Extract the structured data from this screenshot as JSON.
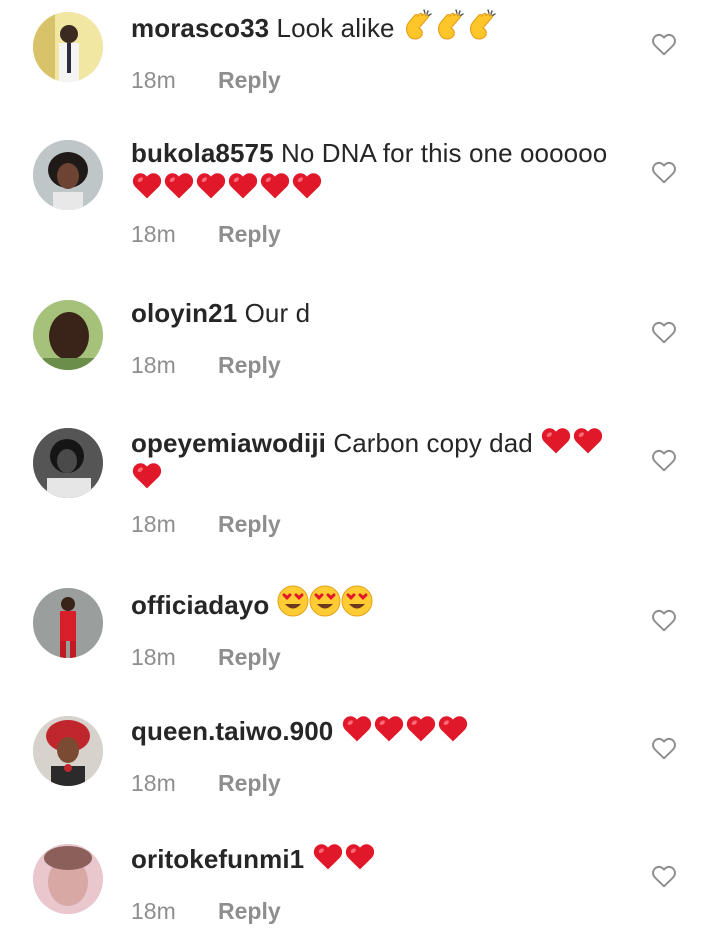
{
  "comments": [
    {
      "username": "morasco33",
      "text": "Look alike",
      "time": "18m",
      "reply": "Reply",
      "emoji": "clap",
      "emoji_count": 3
    },
    {
      "username": "bukola8575",
      "text": "No DNA for this one oooooo",
      "time": "18m",
      "reply": "Reply",
      "emoji": "heart",
      "emoji_count": 6
    },
    {
      "username": "oloyin21",
      "text": "Our d",
      "time": "18m",
      "reply": "Reply",
      "emoji": "none",
      "emoji_count": 0
    },
    {
      "username": "opeyemiawodiji",
      "text": "Carbon copy dad",
      "time": "18m",
      "reply": "Reply",
      "emoji": "heart",
      "emoji_count": 3
    },
    {
      "username": "officiadayo",
      "text": "",
      "time": "18m",
      "reply": "Reply",
      "emoji": "heart-eyes",
      "emoji_count": 3
    },
    {
      "username": "queen.taiwo.900",
      "text": "",
      "time": "18m",
      "reply": "Reply",
      "emoji": "heart",
      "emoji_count": 4
    },
    {
      "username": "oritokefunmi1",
      "text": "",
      "time": "18m",
      "reply": "Reply",
      "emoji": "heart",
      "emoji_count": 2
    }
  ],
  "icons": {
    "like": "heart-outline-icon",
    "avatar": "profile-photo"
  },
  "colors": {
    "text": "#262626",
    "meta": "#8e8e8e",
    "heart": "#e0182a",
    "emoji_yellow": "#ffcc33"
  }
}
